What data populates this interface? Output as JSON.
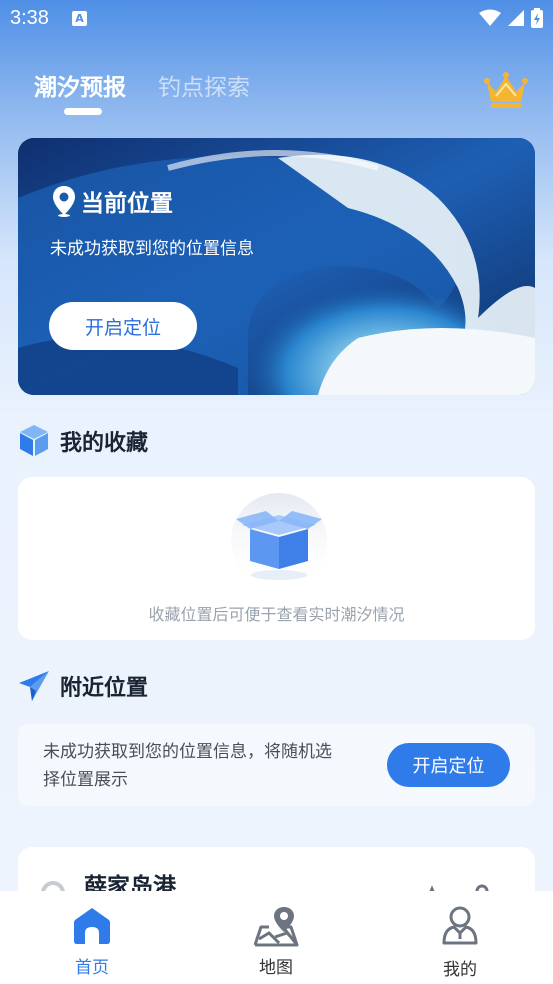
{
  "status_bar": {
    "time": "3:38",
    "a_icon": "A"
  },
  "tabs": [
    {
      "label": "潮汐预报",
      "active": true
    },
    {
      "label": "钓点探索",
      "active": false
    }
  ],
  "hero": {
    "title": "当前位置",
    "subtitle": "未成功获取到您的位置信息",
    "button_label": "开启定位"
  },
  "favorites": {
    "title": "我的收藏",
    "empty_text": "收藏位置后可便于查看实时潮汐情况"
  },
  "nearby": {
    "title": "附近位置",
    "message": "未成功获取到您的位置信息，将随机选择位置展示",
    "button_label": "开启定位"
  },
  "location_card": {
    "name": "薛家岛港"
  },
  "bottom_nav": [
    {
      "label": "首页",
      "icon": "home-icon",
      "active": true
    },
    {
      "label": "地图",
      "icon": "map-icon",
      "active": false
    },
    {
      "label": "我的",
      "icon": "user-icon",
      "active": false
    }
  ],
  "colors": {
    "accent": "#2f7bea",
    "gold": "#f5b531"
  }
}
